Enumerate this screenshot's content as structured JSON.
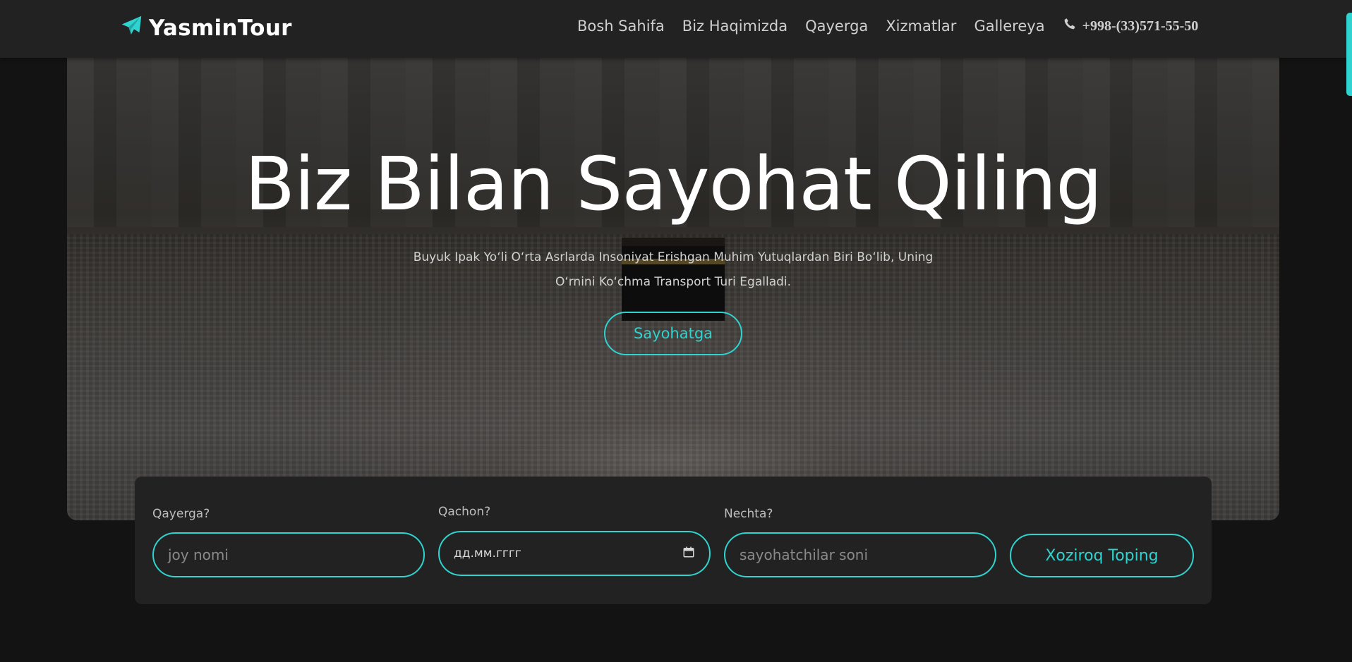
{
  "brand": {
    "name": "YasminTour",
    "icon": "paper-plane-icon"
  },
  "nav": {
    "items": [
      {
        "label": "Bosh Sahifa"
      },
      {
        "label": "Biz Haqimizda"
      },
      {
        "label": "Qayerga"
      },
      {
        "label": "Xizmatlar"
      },
      {
        "label": "Gallereya"
      }
    ],
    "phone": "+998-(33)571-55-50",
    "phone_icon": "phone-icon"
  },
  "hero": {
    "title": "Biz Bilan Sayohat Qiling",
    "subtitle": "Buyuk Ipak Yo‘li O‘rta Asrlarda Insoniyat Erishgan Muhim Yutuqlardan Biri Bo‘lib, Uning O‘rnini Ko‘chma Transport Turi Egalladi.",
    "cta_label": "Sayohatga"
  },
  "search": {
    "where": {
      "label": "Qayerga?",
      "placeholder": "joy nomi"
    },
    "when": {
      "label": "Qachon?",
      "value": "дд.мм.гггг"
    },
    "count": {
      "label": "Nechta?",
      "placeholder": "sayohatchilar soni"
    },
    "submit_label": "Xoziroq Toping"
  },
  "colors": {
    "accent": "#2fd3cf",
    "navbar_bg": "#222222",
    "page_bg": "#131313"
  }
}
